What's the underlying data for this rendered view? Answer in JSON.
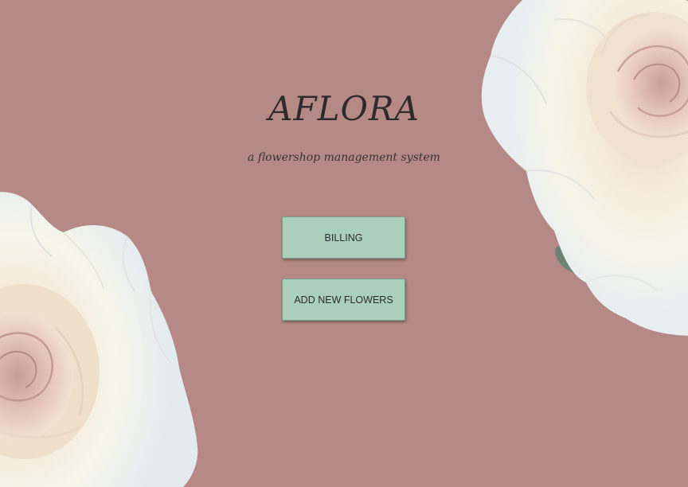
{
  "app": {
    "title": "AFLORA",
    "subtitle": "a flowershop management system"
  },
  "buttons": {
    "billing": "BILLING",
    "add_new_flowers": "ADD NEW FLOWERS"
  },
  "colors": {
    "background": "#b58a86",
    "button_fill": "#aad0bc",
    "text": "#2f2a2b"
  },
  "decorations": {
    "top_right": "white-rose-image",
    "bottom_left": "white-rose-image"
  }
}
